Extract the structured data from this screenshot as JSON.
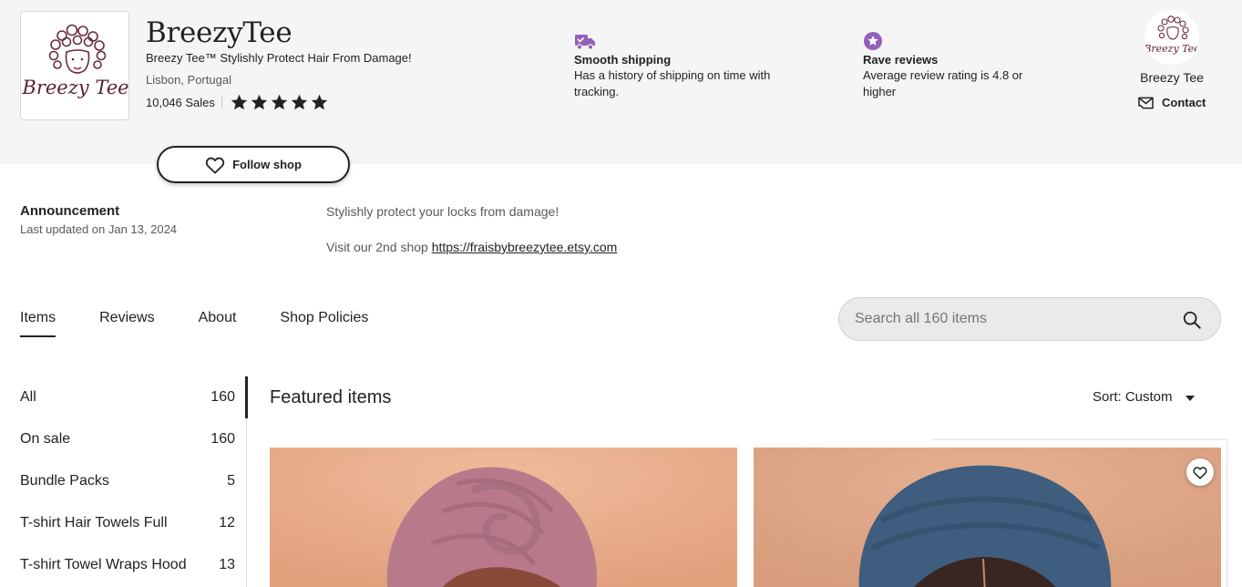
{
  "shop": {
    "name": "BreezyTee",
    "tagline": "Breezy Tee™ Stylishly Protect Hair From Damage!",
    "location": "Lisbon, Portugal",
    "sales": "10,046 Sales",
    "rating_stars": 5,
    "follow_label": "Follow shop",
    "logo_text": "Breezy Tee"
  },
  "perks": {
    "shipping": {
      "icon": "truck-icon",
      "title": "Smooth shipping",
      "description": "Has a history of shipping on time with tracking."
    },
    "reviews": {
      "icon": "star-badge-icon",
      "title": "Rave reviews",
      "description": "Average review rating is 4.8 or higher"
    }
  },
  "owner": {
    "name": "Breezy Tee",
    "contact_label": "Contact",
    "avatar_text": "Breezy Tee"
  },
  "announcement": {
    "title": "Announcement",
    "updated": "Last updated on Jan 13, 2024",
    "line1": "Stylishly protect your locks from damage!",
    "line2_prefix": "Visit our 2nd shop",
    "line2_link": "https://fraisbybreezytee.etsy.com"
  },
  "tabs": [
    {
      "label": "Items",
      "active": true
    },
    {
      "label": "Reviews",
      "active": false
    },
    {
      "label": "About",
      "active": false
    },
    {
      "label": "Shop Policies",
      "active": false
    }
  ],
  "search": {
    "placeholder": "Search all 160 items"
  },
  "sections": [
    {
      "label": "All",
      "count": "160"
    },
    {
      "label": "On sale",
      "count": "160"
    },
    {
      "label": "Bundle Packs",
      "count": "5"
    },
    {
      "label": "T-shirt Hair Towels Full",
      "count": "12"
    },
    {
      "label": "T-shirt Towel Wraps Hood",
      "count": "13"
    }
  ],
  "featured": {
    "title": "Featured items",
    "sort_label": "Sort: Custom"
  },
  "colors": {
    "accent_purple": "#9560b8",
    "header_bg": "#f5f5f5",
    "logo_maroon": "#6b2a3c",
    "listing1_bg": "#e6a585",
    "listing1_wrap": "#b87a8b",
    "listing2_bg": "#d9a180",
    "listing2_wrap": "#3f5d7e"
  }
}
